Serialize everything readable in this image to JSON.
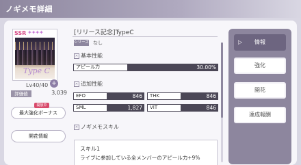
{
  "header": {
    "title": "ノギメモ詳細"
  },
  "card": {
    "rarity": "SSR",
    "stars": "✦✦✦✦",
    "art_text": "Type C",
    "level": "Lv40/40",
    "plus_label": "+"
  },
  "evaluation": {
    "label": "評価値",
    "value": "3,039"
  },
  "buttons": {
    "max_bonus": "最大強化ボーナス",
    "max_badge": "開放中",
    "bloom_info": "開花情報"
  },
  "detail": {
    "name": "[リリース記念]TypeC",
    "series_label": "シリーズ",
    "series_value": "なし",
    "basic_head": "基本性能",
    "appeal_label": "アピール力",
    "appeal_value": "30.00%",
    "extra_head": "追加性能",
    "stats": [
      {
        "label": "EFO",
        "value": "846"
      },
      {
        "label": "THK",
        "value": "846"
      },
      {
        "label": "SML",
        "value": "1,827"
      },
      {
        "label": "VIT",
        "value": "846"
      }
    ],
    "skill_head": "ノギメモスキル",
    "skill_name": "スキル1",
    "skill_desc": "ライブに参加している全メンバーのアピール力+9%"
  },
  "menu": {
    "items": [
      {
        "label": "情報",
        "active": true
      },
      {
        "label": "強化",
        "active": false
      },
      {
        "label": "開花",
        "active": false
      },
      {
        "label": "達成報酬",
        "active": false
      }
    ],
    "arrow": "▷"
  },
  "colors": {
    "accent": "#8d869e",
    "dark_bar": "#4b4756",
    "badge": "#d84a6b"
  }
}
